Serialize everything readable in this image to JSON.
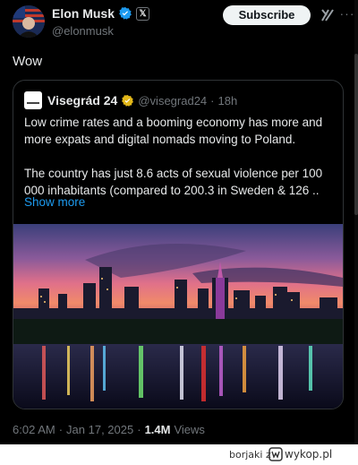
{
  "author": {
    "display_name": "Elon Musk",
    "handle": "@elonmusk",
    "badge": "𝕏"
  },
  "subscribe_label": "Subscribe",
  "more_glyph": "···",
  "tweet_text": "Wow",
  "quote": {
    "display_name": "Visegrád 24",
    "handle": "@visegrad24",
    "separator": "·",
    "time": "18h",
    "paragraph_1": "Low crime rates and a booming economy has more and more expats and digital nomads moving to Poland.",
    "paragraph_2": "The country has just 8.6 acts of sexual violence per 100 000 inhabitants (compared to 200.3 in Sweden & 126 ..",
    "show_more": "Show more"
  },
  "meta": {
    "time": "6:02 AM",
    "separator": "·",
    "date": "Jan 17, 2025",
    "views_count": "1.4M",
    "views_label": "Views"
  },
  "footer": {
    "username": "borjaki",
    "suffix": "z",
    "site": "wykop.pl"
  },
  "colors": {
    "background": "#000000",
    "text": "#e7e9ea",
    "muted": "#71767b",
    "link": "#1d9bf0",
    "verified": "#e2b719"
  }
}
